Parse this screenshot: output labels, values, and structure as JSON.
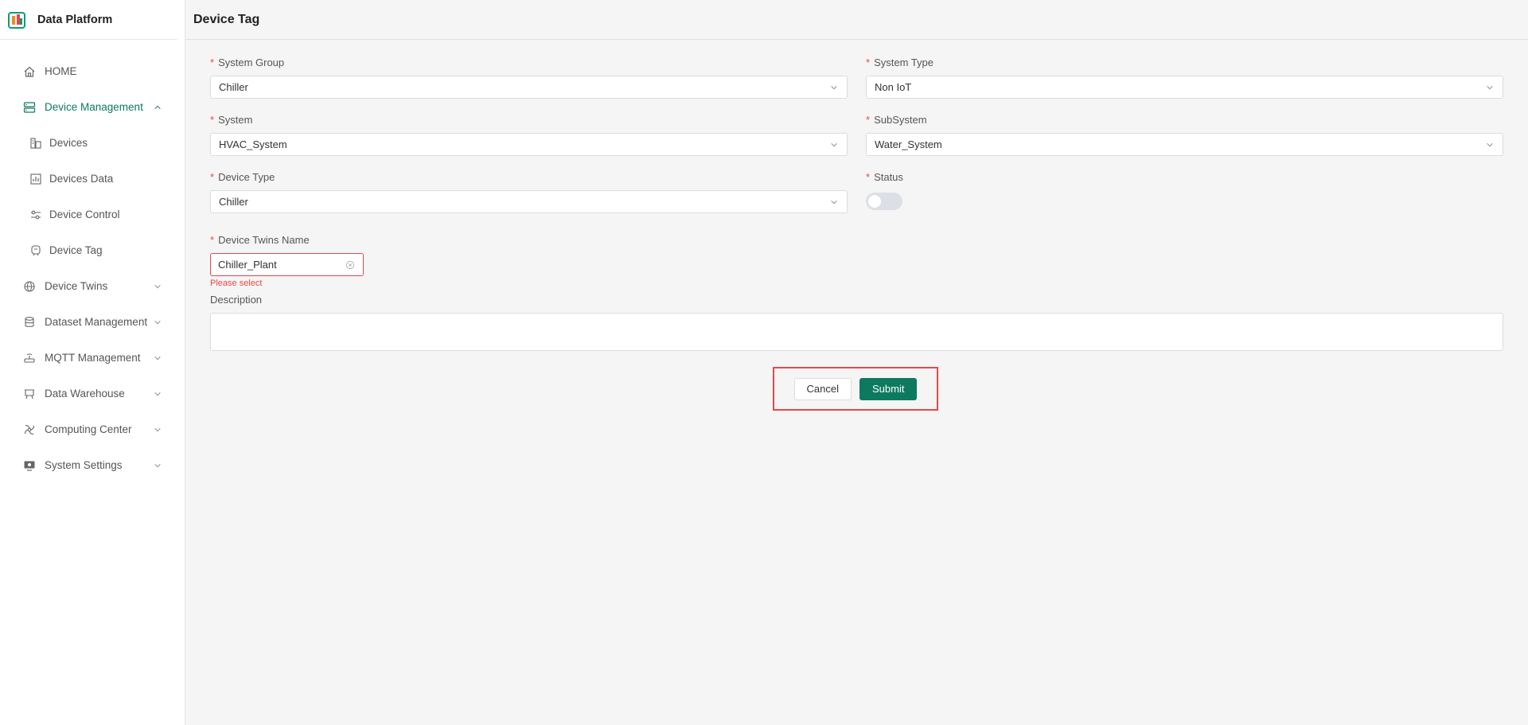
{
  "brand": {
    "title": "Data Platform"
  },
  "sidebar": {
    "items": [
      {
        "label": "HOME",
        "icon": "home-icon"
      },
      {
        "label": "Device Management",
        "icon": "server-icon",
        "expanded": true
      },
      {
        "label": "Devices",
        "icon": "devices-icon"
      },
      {
        "label": "Devices Data",
        "icon": "chart-icon"
      },
      {
        "label": "Device Control",
        "icon": "sliders-icon"
      },
      {
        "label": "Device Tag",
        "icon": "tag-icon"
      },
      {
        "label": "Device Twins",
        "icon": "globe-icon"
      },
      {
        "label": "Dataset Management",
        "icon": "database-icon"
      },
      {
        "label": "MQTT Management",
        "icon": "router-icon"
      },
      {
        "label": "Data Warehouse",
        "icon": "warehouse-icon"
      },
      {
        "label": "Computing Center",
        "icon": "network-icon"
      },
      {
        "label": "System Settings",
        "icon": "monitor-icon"
      }
    ]
  },
  "header": {
    "title": "Device Tag"
  },
  "form": {
    "system_group": {
      "label": "System Group",
      "value": "Chiller"
    },
    "system_type": {
      "label": "System Type",
      "value": "Non IoT"
    },
    "system": {
      "label": "System",
      "value": "HVAC_System"
    },
    "subsystem": {
      "label": "SubSystem",
      "value": "Water_System"
    },
    "device_type": {
      "label": "Device Type",
      "value": "Chiller"
    },
    "status": {
      "label": "Status",
      "enabled": false
    },
    "device_twins_name": {
      "label": "Device Twins Name",
      "value": "Chiller_Plant",
      "error": "Please select"
    },
    "description": {
      "label": "Description",
      "value": ""
    },
    "required_mark": "*"
  },
  "actions": {
    "cancel_label": "Cancel",
    "submit_label": "Submit"
  },
  "colors": {
    "accent": "#0d7a5f",
    "error": "#e8474a"
  }
}
